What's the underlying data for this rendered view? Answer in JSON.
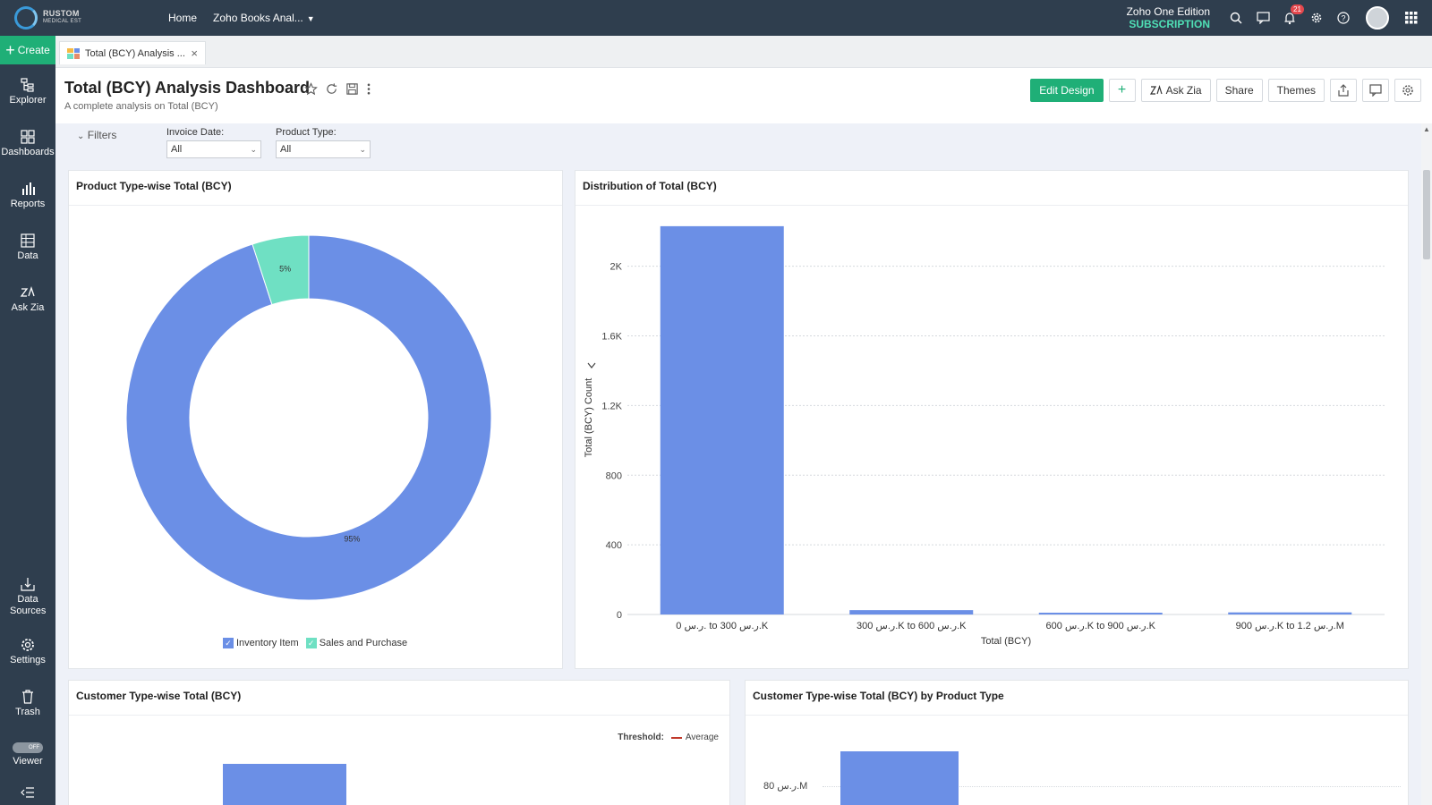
{
  "topbar": {
    "org_name": "RUSTOM",
    "org_sub": "MEDICAL EST",
    "nav": [
      "Home",
      "Zoho Books Anal..."
    ],
    "edition": "Zoho One Edition",
    "subscription": "SUBSCRIPTION",
    "notifications": "21"
  },
  "sidebar": {
    "create": "Create",
    "items": [
      "Explorer",
      "Dashboards",
      "Reports",
      "Data",
      "Ask Zia",
      "Data Sources",
      "Settings",
      "Trash",
      "Viewer"
    ],
    "toggle_text": "OFF"
  },
  "tab": {
    "label": "Total (BCY) Analysis ..."
  },
  "dashboard": {
    "title": "Total (BCY) Analysis Dashboard",
    "subtitle": "A complete analysis on Total (BCY)",
    "actions": {
      "edit_design": "Edit Design",
      "ask_zia": "Ask Zia",
      "share": "Share",
      "themes": "Themes"
    }
  },
  "filters": {
    "toggle": "Filters",
    "invoice_date": {
      "label": "Invoice Date:",
      "value": "All"
    },
    "product_type": {
      "label": "Product Type:",
      "value": "All"
    }
  },
  "panels": {
    "p1_title": "Product Type-wise Total (BCY)",
    "p2_title": "Distribution of Total (BCY)",
    "p3_title": "Customer Type-wise Total (BCY)",
    "p4_title": "Customer Type-wise Total (BCY) by Product Type",
    "threshold_label": "Threshold:",
    "threshold_value": "Average",
    "p4_tick": "80 ر.س.M"
  },
  "colors": {
    "primary_blue": "#6b8fe6",
    "teal": "#6fe0c3",
    "green": "#1faf77",
    "navy": "#2f3e4e"
  },
  "chart_data": [
    {
      "type": "pie",
      "title": "Product Type-wise Total (BCY)",
      "categories": [
        "Inventory Item",
        "Sales and Purchase"
      ],
      "values": [
        95,
        5
      ],
      "labels": [
        "95%",
        "5%"
      ],
      "legend": "bottom"
    },
    {
      "type": "bar",
      "title": "Distribution of Total (BCY)",
      "categories": [
        "0 ر.س. to 300 ر.س.K",
        "300 ر.س.K to 600 ر.س.K",
        "600 ر.س.K to 900 ر.س.K",
        "900 ر.س.K to 1.2 ر.س.M"
      ],
      "values": [
        2230,
        25,
        8,
        12
      ],
      "xlabel": "Total (BCY)",
      "ylabel": "Total (BCY) Count",
      "yticks": [
        "0",
        "400",
        "800",
        "1.2K",
        "1.6K",
        "2K"
      ],
      "ylim": [
        0,
        2250
      ],
      "grid": true
    }
  ]
}
